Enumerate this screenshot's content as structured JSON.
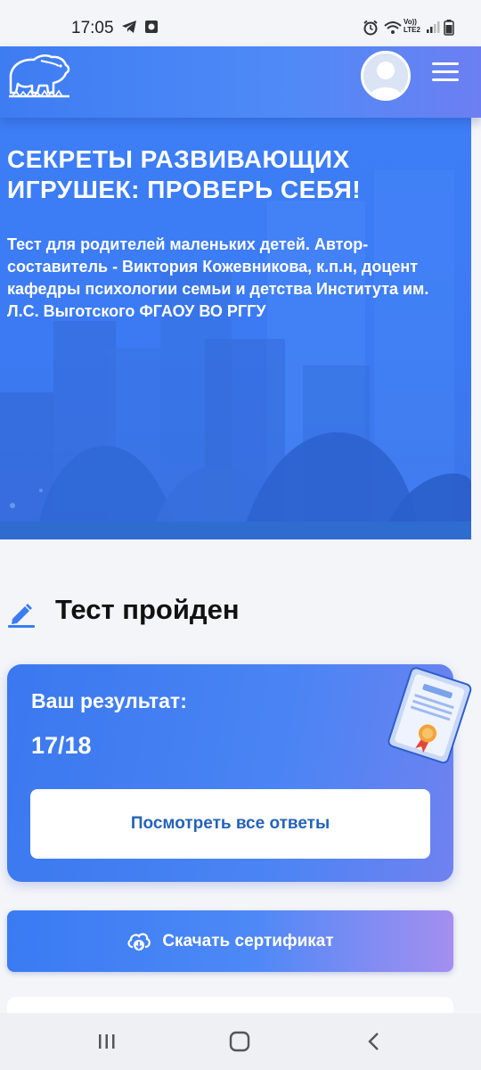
{
  "status_bar": {
    "time": "17:05",
    "left_icons": [
      "telegram-icon",
      "media-icon"
    ],
    "right_icons": [
      "alarm-icon",
      "wifi-icon",
      "volte-icon",
      "signal-icon",
      "battery-icon"
    ],
    "volte_text": "Vo)) LTE2"
  },
  "header": {
    "logo_icon": "bear-logo-icon",
    "avatar_icon": "user-avatar-icon",
    "menu_icon": "hamburger-menu-icon"
  },
  "hero": {
    "title": "СЕКРЕТЫ РАЗВИВАЮЩИХ ИГРУШЕК: ПРОВЕРЬ СЕБЯ!",
    "description": "Тест для родителей маленьких детей. Автор-составитель - Виктория Кожевникова, к.п.н, доцент кафедры психологии семьи и детства Института им. Л.С. Выготского ФГАОУ ВО РГГУ"
  },
  "result_section": {
    "title": "Тест пройден",
    "title_icon": "pencil-icon",
    "result_label": "Ваш результат:",
    "score": "17/18",
    "view_answers_label": "Посмотреть все ответы",
    "certificate_icon": "certificate-icon"
  },
  "download": {
    "label": "Скачать сертификат",
    "icon": "cloud-download-icon"
  },
  "nav_bar": {
    "buttons": [
      "recent-apps-icon",
      "home-icon",
      "back-icon"
    ]
  },
  "colors": {
    "brand_blue": "#3e7cf2",
    "button_text_blue": "#2563b8",
    "accent_purple": "#a48ff0"
  }
}
